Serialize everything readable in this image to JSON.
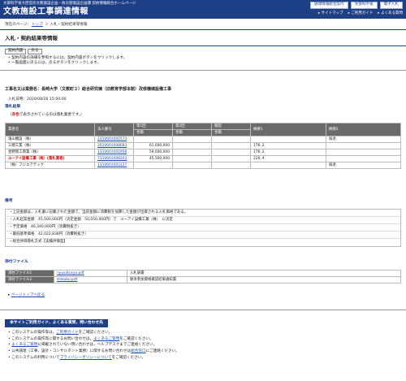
{
  "header": {
    "subtitle": "文部科学省大臣官房文教施設企画・防災部施設企画課 契約情報総合ホームページ",
    "title": "文教施設工事調達情報",
    "buttons": [
      "調達情報総合案内",
      "文部科学省",
      "電子入札"
    ],
    "links": [
      "サイトマップ",
      "ご利用ガイド",
      "よくある質問"
    ]
  },
  "breadcrumb": {
    "label": "現在のページ：",
    "top": "トップ",
    "sep": "＞",
    "current": "入札・契約結果等情報"
  },
  "page_title": "入札・契約結果等情報",
  "tool_buttons": [
    "契約内容",
    "戻る"
  ],
  "notes": [
    "契約内容の詳細を参照するには，契約内容ボタンをクリックします。",
    "一覧画面に戻るには，戻るボタンをクリックします。"
  ],
  "project": "工事名又は業務名：長崎大学（文教町２）総合研究棟（旧教育学部本館）改修機械設備工事",
  "date": {
    "label": "入札日時：",
    "value": "2020/08/26 15:00:00"
  },
  "sections": {
    "result": "落札結果",
    "remarks": "備考",
    "attach": "添付ファイル"
  },
  "red_note": {
    "pre": "（",
    "red": "赤色",
    "post": "で表示されているのは落札業者です。）"
  },
  "table": {
    "headers": [
      "業者名",
      "法人番号",
      "第1回",
      "第2回",
      "随契",
      "摘要1",
      "摘要2"
    ],
    "sub": [
      "金額",
      "金額",
      "金額"
    ],
    "rows": [
      {
        "name": "濱山機設（株）",
        "corp": "2310001002573",
        "r1": "",
        "r2": "",
        "zk": "",
        "t1": "",
        "t2": "辞退",
        "win": false
      },
      {
        "name": "三幌工業（株）",
        "corp": "2010001008683",
        "r1": "61,000,000",
        "r2": "",
        "zk": "",
        "t1": "176,２",
        "t2": "",
        "win": false
      },
      {
        "name": "星野管工興業（株）",
        "corp": "1310001001956",
        "r1": "59,000,000",
        "r2": "",
        "zk": "",
        "t1": "176,２",
        "t2": "",
        "win": false
      },
      {
        "name": "ユーアイ設備工業（株）(落札業者)",
        "corp": "7310001008203",
        "r1": "45,500,000",
        "r2": "",
        "zk": "",
        "t1": "226,４",
        "t2": "",
        "win": true
      },
      {
        "name": "（株）フジエアテック",
        "corp": "1310001003127",
        "r1": "",
        "r2": "",
        "zk": "",
        "t1": "",
        "t2": "辞退",
        "win": false
      }
    ]
  },
  "remarks": [
    "・上記金額は，入札書に記載された金額で，当該金額に消費税を加算した金額が出資される入札価格である。",
    "・入札起案金額　45,500,000円（決定金額　50,050,000円）で　ユーアイ設備工業（株）　に決定",
    "・予定価格　46,340,000円（消費税抜き）",
    "・最低基準価格　42,022,838円（消費税抜き）",
    "・総合評価落札方式【実績評価型】"
  ],
  "attachments": [
    {
      "label": "添付ファイル1",
      "file": "nyusatusyo.pdf",
      "desc": "入札調書"
    },
    {
      "label": "添付ファイル2",
      "file": "shikaku.pdf",
      "desc": "競争参加資格確認結果通知書"
    }
  ],
  "page_top": "ページトップへ戻る",
  "footer": {
    "heading": "本サイトご利用ガイド，よくある質問，問い合わせ先",
    "items": [
      {
        "pre": "このシステムの操作等は，",
        "link": "ご利用ガイド",
        "post": "をご確認ください。"
      },
      {
        "pre": "このシステムの操作等に関するお問い合わせは，",
        "link": "よくあるご質問",
        "post": "をご確認ください。"
      },
      {
        "pre": "",
        "link": "よくあるご質問",
        "post": "に掲載されていない問い合わせは，ヘルプデスクまでご連絡ください。"
      },
      {
        "pre": "公共調達（工事，設計・コンサルタント業務）に関するお問い合わせは",
        "link": "総合窓口",
        "post": "にご連絡ください。"
      },
      {
        "pre": "このシステムの利用について",
        "link": "プライバシーポリシーについて",
        "post": "をご確認ください。"
      }
    ]
  }
}
